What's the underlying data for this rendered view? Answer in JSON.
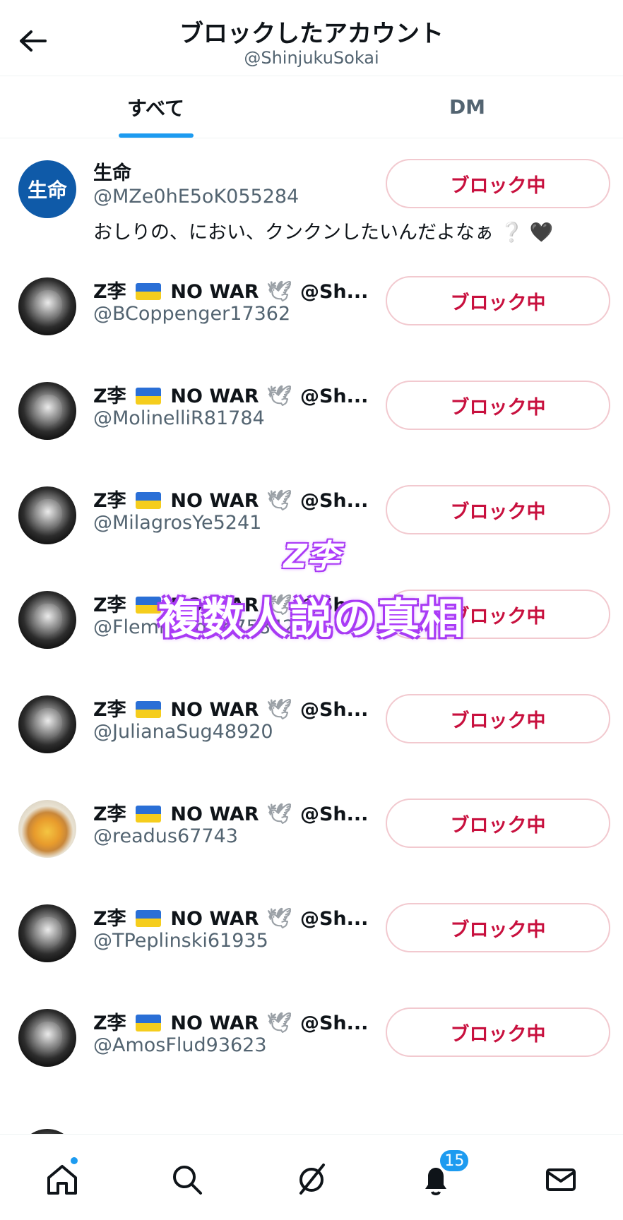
{
  "header": {
    "title": "ブロックしたアカウント",
    "subtitle": "@ShinjukuSokai"
  },
  "tabs": [
    {
      "label": "すべて",
      "active": true
    },
    {
      "label": "DM",
      "active": false
    }
  ],
  "block_button_label": "ブロック中",
  "accounts": [
    {
      "avatar": "text",
      "avatar_text": "生命",
      "name": "生命",
      "handle": "@MZe0hE5oK055284",
      "bio": "おしりの、におい、クンクンしたいんだよなぁ ❔ 🖤"
    },
    {
      "avatar": "face",
      "name_prefix": "Z李",
      "name_middle": "NO WAR",
      "name_suffix": "@Sh...",
      "handle": "@BCoppenger17362"
    },
    {
      "avatar": "face",
      "name_prefix": "Z李",
      "name_middle": "NO WAR",
      "name_suffix": "@Sh...",
      "handle": "@MolinelliR81784"
    },
    {
      "avatar": "face",
      "name_prefix": "Z李",
      "name_middle": "NO WAR",
      "name_suffix": "@Sh...",
      "handle": "@MilagrosYe5241"
    },
    {
      "avatar": "face",
      "name_prefix": "Z李",
      "name_middle": "NO WAR",
      "name_suffix": "@Sh...",
      "handle": "@FlemmingOd75842"
    },
    {
      "avatar": "face",
      "name_prefix": "Z李",
      "name_middle": "NO WAR",
      "name_suffix": "@Sh...",
      "handle": "@JulianaSug48920"
    },
    {
      "avatar": "food",
      "name_prefix": "Z李",
      "name_middle": "NO WAR",
      "name_suffix": "@Sh...",
      "handle": "@readus67743"
    },
    {
      "avatar": "face",
      "name_prefix": "Z李",
      "name_middle": "NO WAR",
      "name_suffix": "@Sh...",
      "handle": "@TPeplinski61935"
    },
    {
      "avatar": "face",
      "name_prefix": "Z李",
      "name_middle": "NO WAR",
      "name_suffix": "@Sh...",
      "handle": "@AmosFlud93623"
    }
  ],
  "overlay": {
    "line1": "Z李",
    "line2": "複数人説の真相"
  },
  "bottom_nav": {
    "notifications_count": "15",
    "icons": [
      "home-icon",
      "search-icon",
      "spaces-icon",
      "bell-icon",
      "mail-icon"
    ]
  },
  "colors": {
    "accent": "#1d9bf0",
    "block_red": "#c8103e",
    "overlay_purple": "#a53bf0"
  }
}
